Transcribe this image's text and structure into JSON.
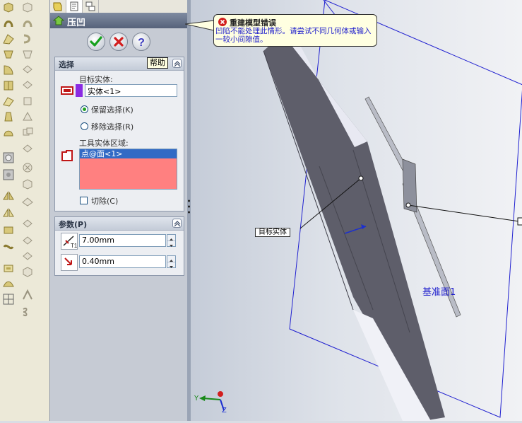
{
  "property_manager": {
    "title": "压凹",
    "ok_label": "ok",
    "cancel_label": "cancel",
    "help_label": "?",
    "selection": {
      "title": "选择",
      "help_tooltip": "帮助",
      "target_body_label": "目标实体:",
      "target_body_value": "实体<1>",
      "keep_selection": "保留选择(K)",
      "remove_selection": "移除选择(R)",
      "tool_region_label": "工具实体区域:",
      "tool_region_items": [
        "点@面<1>"
      ],
      "cut_label": "切除(C)"
    },
    "parameters": {
      "title": "参数(P)",
      "thickness_value": "7.00mm",
      "clearance_value": "0.40mm"
    }
  },
  "error_callout": {
    "title": "重建模型错误",
    "message": "凹陷不能处理此情形。请尝试不同几何体或输入一较小间隙值。"
  },
  "viewport": {
    "target_body_tag": "目标实体",
    "plane_label": "基准面1",
    "axis_y": "Y",
    "axis_z": "Z"
  },
  "colors": {
    "accent_purple": "#8a2be2",
    "list_highlight": "#316ac5",
    "list_bg": "#ff8080",
    "plane_blue": "#1a1acc"
  }
}
